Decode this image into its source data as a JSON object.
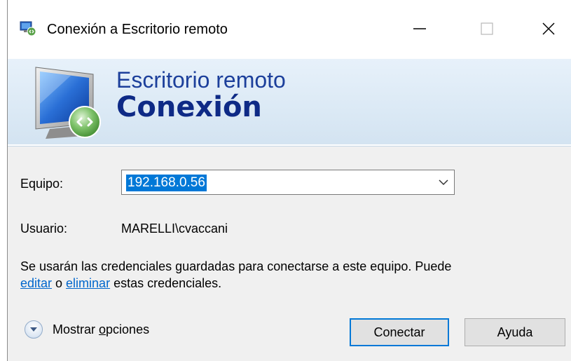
{
  "window": {
    "title": "Conexión a Escritorio remoto",
    "controls": {
      "minimize_icon": "minimize-icon",
      "maximize_icon": "maximize-icon",
      "close_icon": "close-icon"
    }
  },
  "banner": {
    "line1": "Escritorio remoto",
    "line2": "Conexión"
  },
  "form": {
    "computer_label": "Equipo:",
    "computer_value": "192.168.0.56",
    "user_label": "Usuario:",
    "user_value": "MARELLI\\cvaccani",
    "info_prefix": "Se usarán las credenciales guardadas para conectarse a este equipo.  Puede ",
    "edit_link": "editar",
    "or_text": " o ",
    "delete_link": "eliminar",
    "info_suffix": " estas credenciales."
  },
  "footer": {
    "show_options_prefix": "Mostrar ",
    "show_options_accel": "o",
    "show_options_suffix": "pciones",
    "connect_label": "Conectar",
    "help_label": "Ayuda"
  },
  "colors": {
    "accent": "#0078d7",
    "banner_text": "#1c3f9b",
    "link": "#0066cc"
  }
}
